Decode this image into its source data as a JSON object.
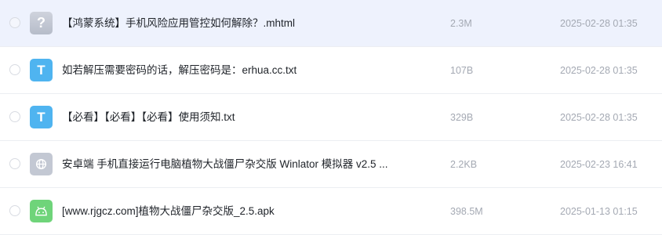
{
  "files": [
    {
      "name": "【鸿蒙系统】手机风险应用管控如何解除？.mhtml",
      "size": "2.3M",
      "date": "2025-02-28 01:35",
      "icon": "unknown-file-icon",
      "icon_glyph": "?",
      "selected": true
    },
    {
      "name": "如若解压需要密码的话，解压密码是：erhua.cc.txt",
      "size": "107B",
      "date": "2025-02-28 01:35",
      "icon": "text-file-icon",
      "icon_glyph": "T",
      "selected": false
    },
    {
      "name": "【必看】【必看】【必看】使用须知.txt",
      "size": "329B",
      "date": "2025-02-28 01:35",
      "icon": "text-file-icon",
      "icon_glyph": "T",
      "selected": false
    },
    {
      "name": "安卓端 手机直接运行电脑植物大战僵尸杂交版 Winlator 模拟器 v2.5 ...",
      "size": "2.2KB",
      "date": "2025-02-23 16:41",
      "icon": "link-file-icon",
      "icon_glyph": "",
      "selected": false
    },
    {
      "name": "[www.rjgcz.com]植物大战僵尸杂交版_2.5.apk",
      "size": "398.5M",
      "date": "2025-01-13 01:15",
      "icon": "android-apk-icon",
      "icon_glyph": "",
      "selected": false
    }
  ],
  "colors": {
    "selected_row_bg": "#eef2fd",
    "text_primary": "#1f2329",
    "text_secondary": "#a4a9b3",
    "txt_icon": "#4fb4f0",
    "apk_icon": "#6fd47a",
    "unknown_icon": "#c3c8d3"
  }
}
